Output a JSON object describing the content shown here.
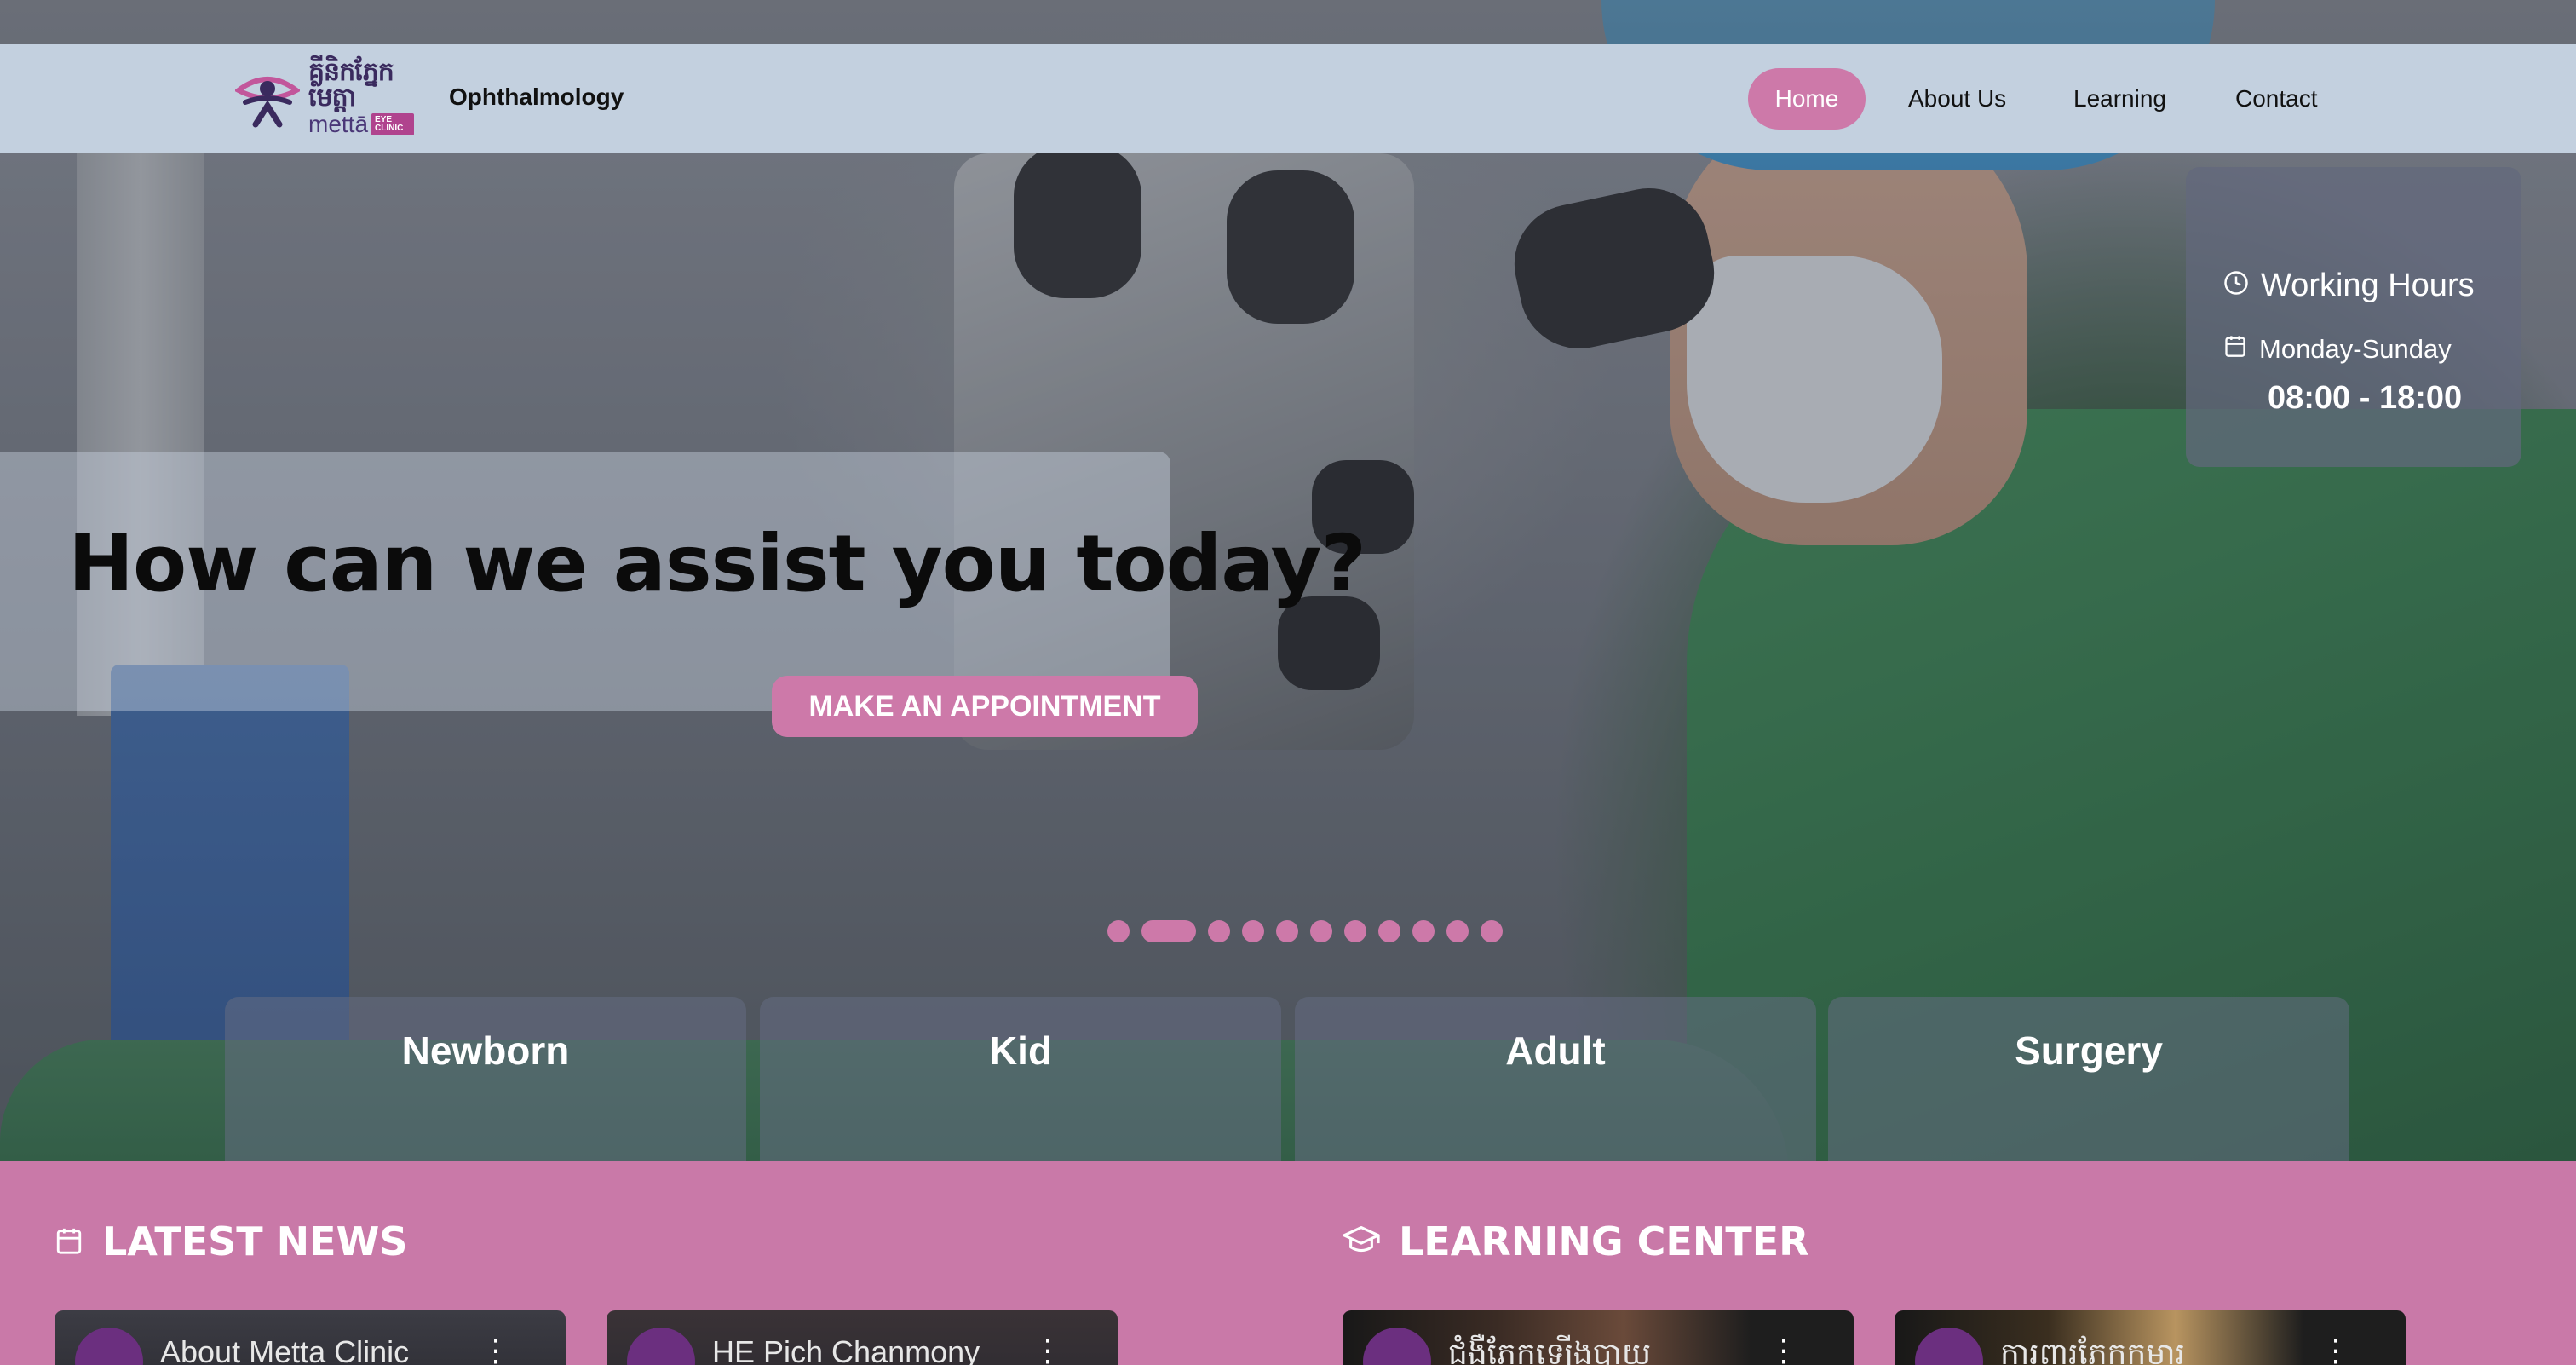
{
  "header": {
    "logo": {
      "khmer": "គ្លីនិកភ្នែក មេត្តា",
      "latin": "mettā",
      "badge": "EYE CLINIC"
    },
    "brand": "Ophthalmology",
    "nav": [
      {
        "label": "Home",
        "active": true
      },
      {
        "label": "About Us",
        "active": false
      },
      {
        "label": "Learning",
        "active": false
      },
      {
        "label": "Contact",
        "active": false
      }
    ]
  },
  "hero": {
    "heading": "How can we assist you today?",
    "cta_label": "MAKE AN APPOINTMENT",
    "slides": {
      "count": 11,
      "active_index": 1
    }
  },
  "working_hours": {
    "title": "Working Hours",
    "days": "Monday-Sunday",
    "time": "08:00 - 18:00"
  },
  "categories": [
    "Newborn",
    "Kid",
    "Adult",
    "Surgery"
  ],
  "sections": {
    "news": {
      "title": "LATEST NEWS",
      "videos": [
        {
          "title": "About Metta Clinic"
        },
        {
          "title": "HE Pich Chanmony"
        }
      ]
    },
    "learning": {
      "title": "LEARNING CENTER",
      "videos": [
        {
          "title": "ជំងឺភ្នែកឡើងបាយ"
        },
        {
          "title": "ការពារភ្នែកកុមារ"
        }
      ]
    }
  },
  "colors": {
    "accent": "#cd79a9",
    "header_bg": "#c3d0df",
    "section_bg": "#c979a8",
    "brand_purple": "#4a3777"
  },
  "icons": {
    "hours": "clock-icon",
    "days": "calendar-icon",
    "news": "calendar-icon",
    "learning": "graduation-cap-icon",
    "video_menu": "more-vertical-icon"
  }
}
